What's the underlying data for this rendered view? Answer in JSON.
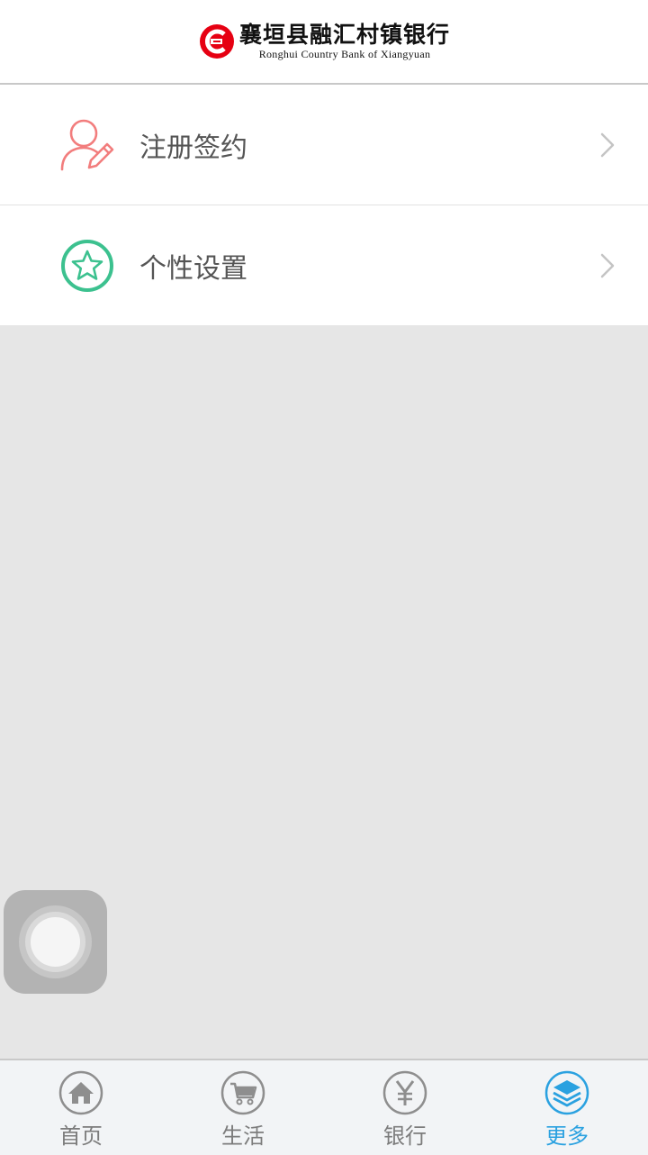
{
  "header": {
    "logo_cn": "襄垣县融汇村镇银行",
    "logo_en": "Ronghui Country Bank of Xiangyuan"
  },
  "menu": {
    "items": [
      {
        "label": "注册签约",
        "icon": "user-edit-icon",
        "color": "#f27d7d"
      },
      {
        "label": "个性设置",
        "icon": "star-icon",
        "color": "#3cc18f"
      }
    ]
  },
  "tabs": [
    {
      "label": "首页",
      "icon": "home-icon",
      "active": false
    },
    {
      "label": "生活",
      "icon": "cart-icon",
      "active": false
    },
    {
      "label": "银行",
      "icon": "yen-icon",
      "active": false
    },
    {
      "label": "更多",
      "icon": "layers-icon",
      "active": true
    }
  ],
  "colors": {
    "brand_red": "#e60012",
    "active_tab": "#2aa1e0",
    "inactive_tab": "#7c7c7c",
    "background": "#e6e6e6"
  }
}
